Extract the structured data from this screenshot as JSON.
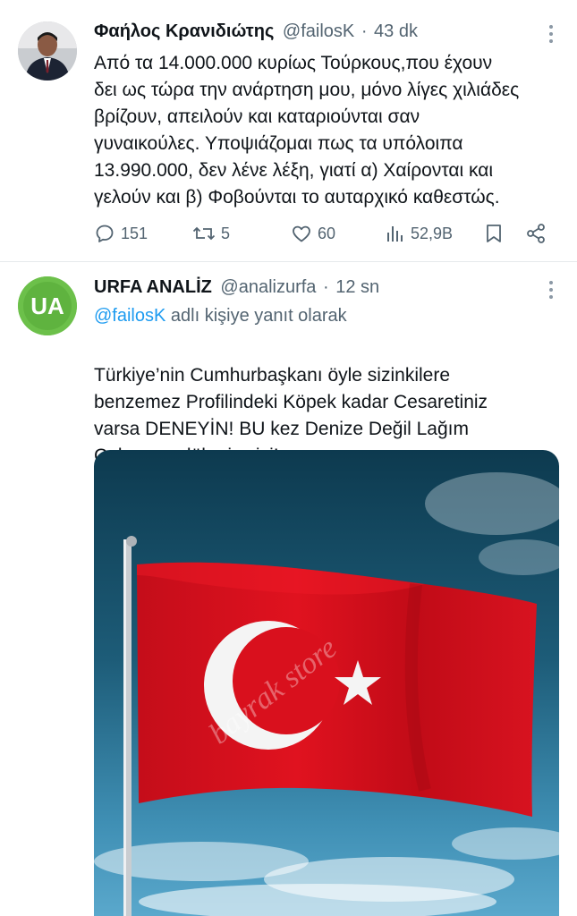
{
  "tweet1": {
    "display_name": "Φαήλος Κρανιδιώτης",
    "handle": "@failosK",
    "separator": "·",
    "time": "43 dk",
    "text": "Από τα 14.000.000 κυρίως Τούρκους,που έχουν\nδει ως τώρα την ανάρτηση μου, μόνο λίγες χιλιάδες\nβρίζουν, απειλούν και καταριούνται σαν\nγυναικούλες. Υποψιάζομαι πως τα υπόλοιπα\n13.990.000, δεν λένε λέξη, γιατί α) Χαίρονται και\nγελούν και β) Φοβούνται το αυταρχικό καθεστώς.",
    "actions": {
      "replies": "151",
      "retweets": "5",
      "likes": "60",
      "views": "52,9B"
    }
  },
  "tweet2": {
    "display_name": "URFA ANALİZ",
    "handle": "@analizurfa",
    "separator": "·",
    "time": "12 sn",
    "reply_to_handle": "@failosK",
    "reply_to_suffix": " adlı kişiye yanıt olarak",
    "text": "Türkiye’nin Cumhurbaşkanı öyle sizinkilere\nbenzemez Profilindeki Köpek kadar Cesaretiniz\nvarsa DENEYİN! BU kez Denize Değil Lağım\nÇukuruna dökeriz  sizi!",
    "flag_emoji_count": 6,
    "avatar_text": "UA",
    "media_watermark": "bayrak store"
  },
  "colors": {
    "accent": "#1d9bf0",
    "muted": "#536471",
    "flag_red": "#e30a17",
    "ua_green": "#6cc04a"
  },
  "icons": [
    "more-icon",
    "reply-icon",
    "retweet-icon",
    "like-icon",
    "views-icon",
    "bookmark-icon",
    "share-icon"
  ]
}
